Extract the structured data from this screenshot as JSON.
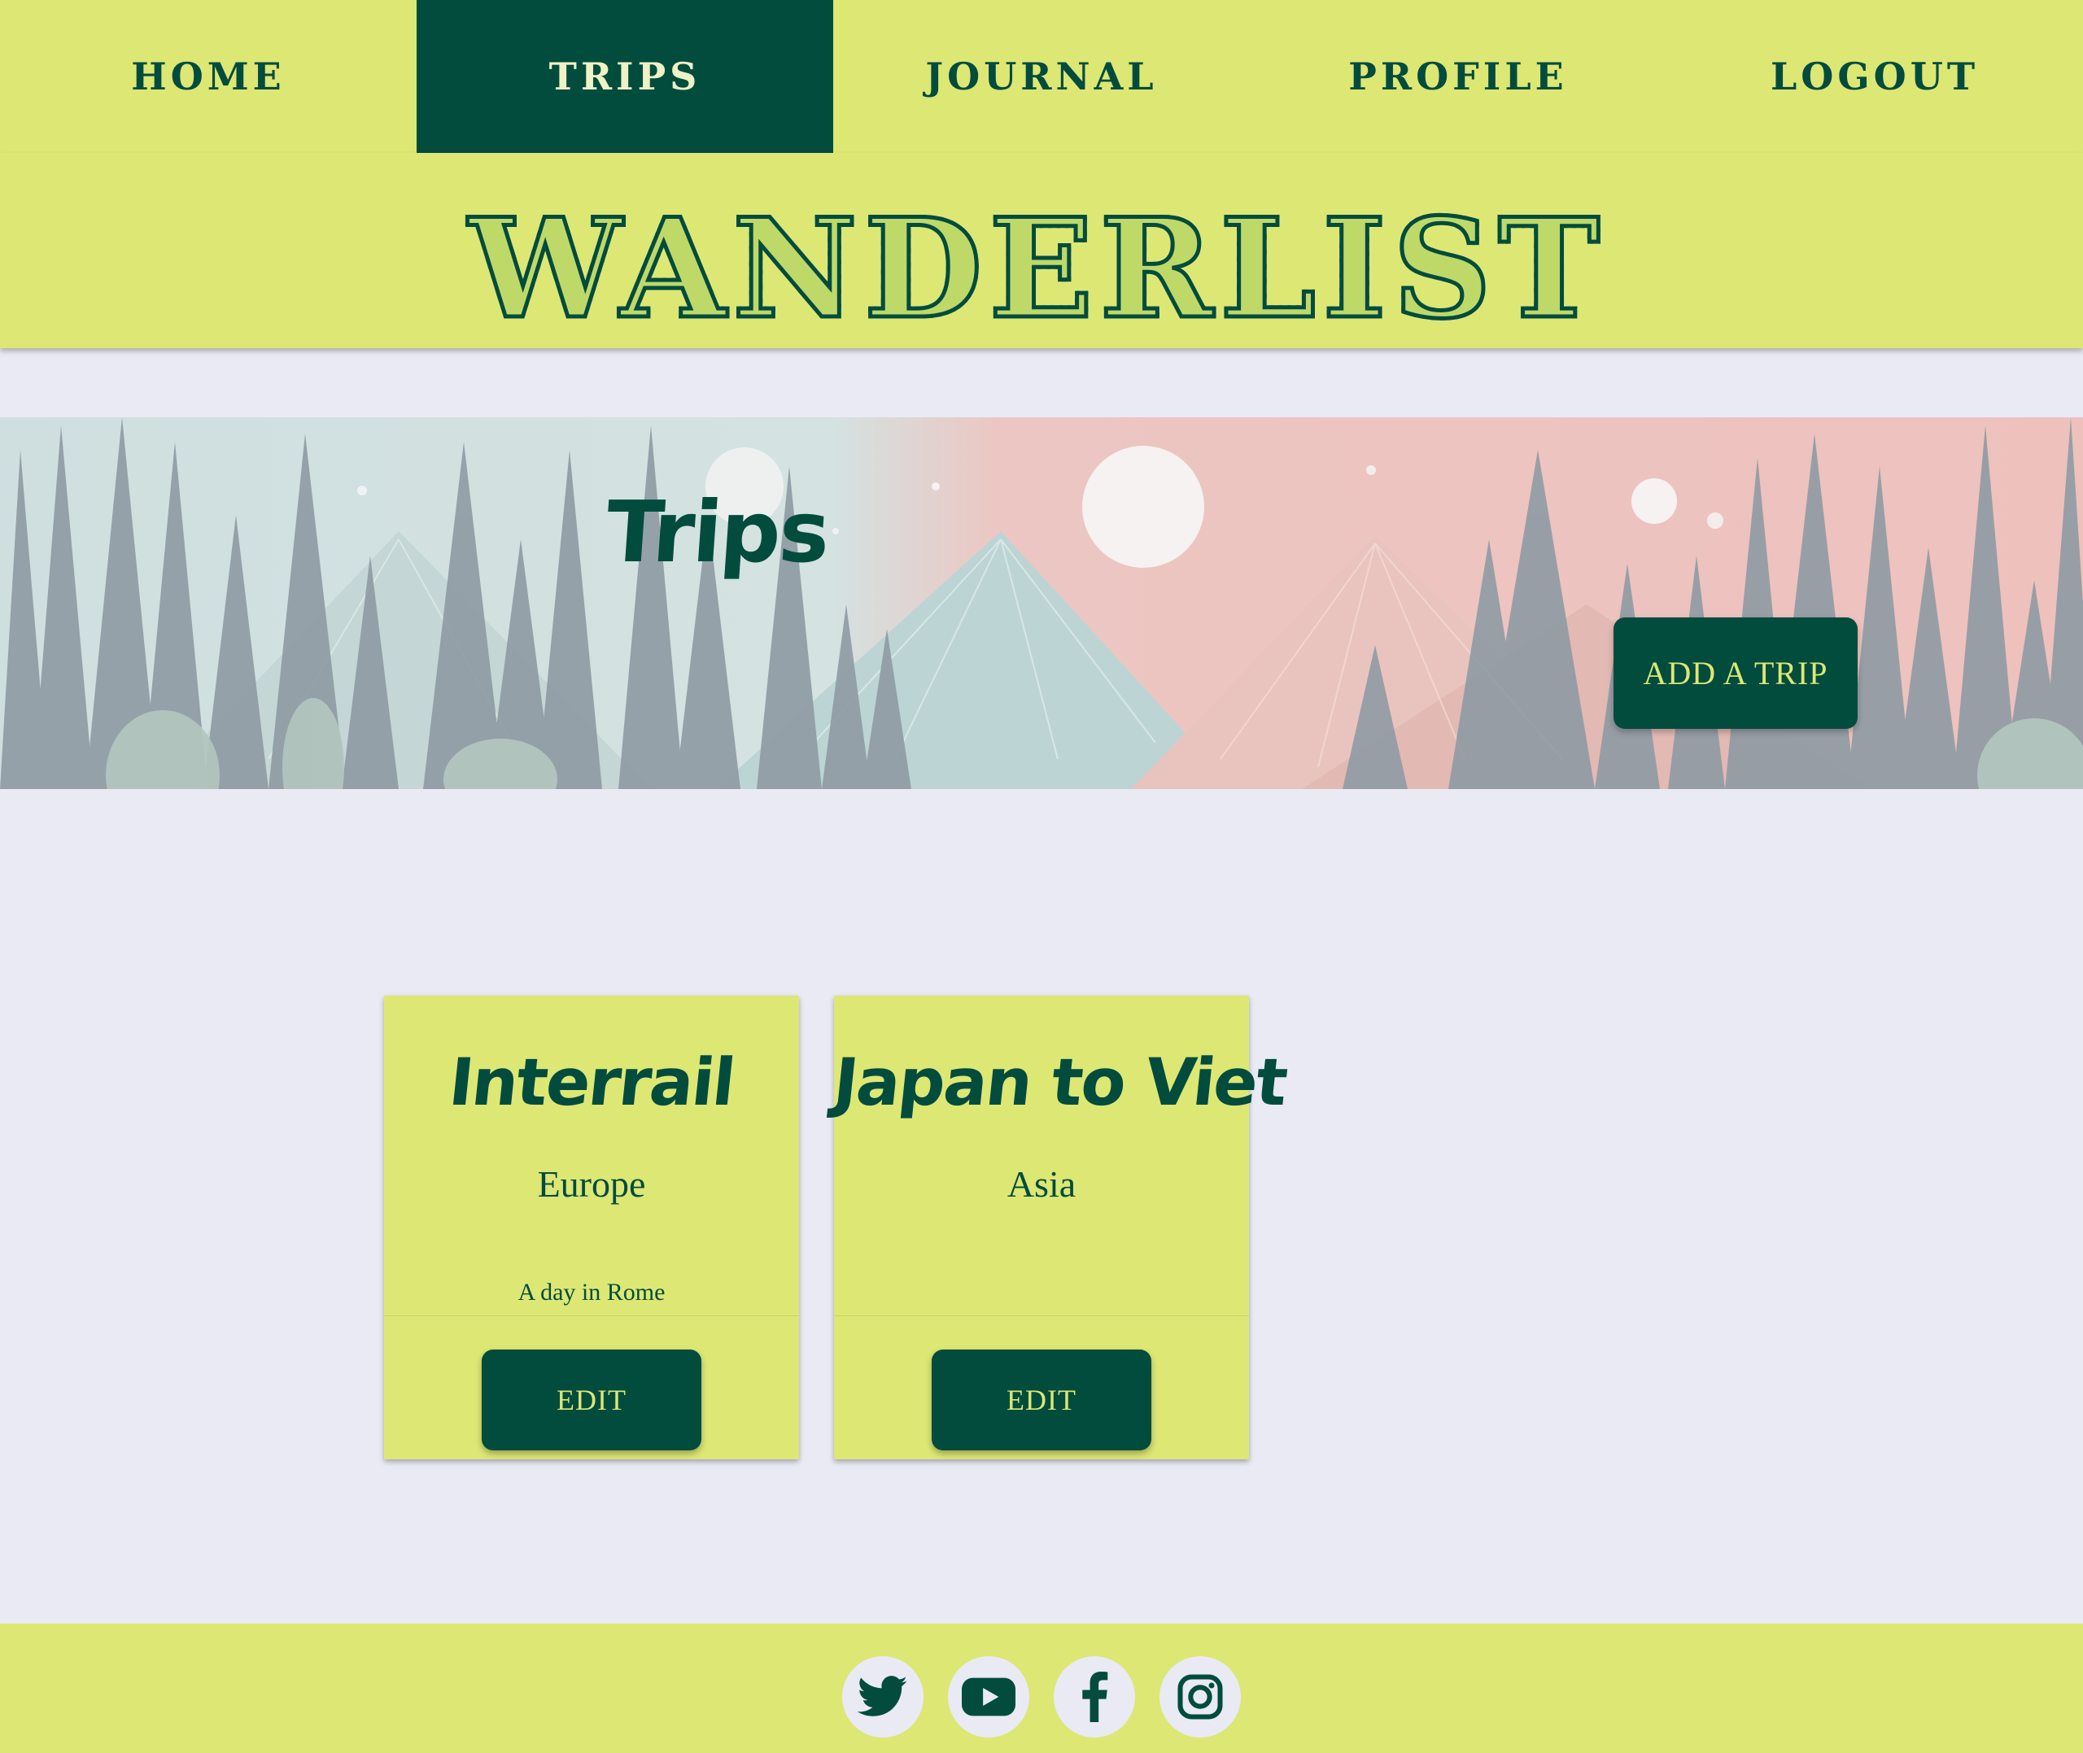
{
  "nav": {
    "items": [
      {
        "label": "HOME",
        "active": false
      },
      {
        "label": "TRIPS",
        "active": true
      },
      {
        "label": "JOURNAL",
        "active": false
      },
      {
        "label": "PROFILE",
        "active": false
      },
      {
        "label": "LOGOUT",
        "active": false
      }
    ]
  },
  "header": {
    "brand": "WANDERLIST"
  },
  "hero": {
    "title": "Trips",
    "add_button": "ADD A TRIP"
  },
  "trips": [
    {
      "title": "Interrail",
      "region": "Europe",
      "note": "A day in Rome",
      "edit_label": "EDIT"
    },
    {
      "title": "Japan to Viet",
      "region": "Asia",
      "note": "",
      "edit_label": "EDIT"
    }
  ],
  "footer": {
    "social": [
      "twitter-icon",
      "youtube-icon",
      "facebook-icon",
      "instagram-icon"
    ]
  },
  "colors": {
    "primary": "#024c3e",
    "accent": "#dde774",
    "background": "#e9eaf4"
  }
}
